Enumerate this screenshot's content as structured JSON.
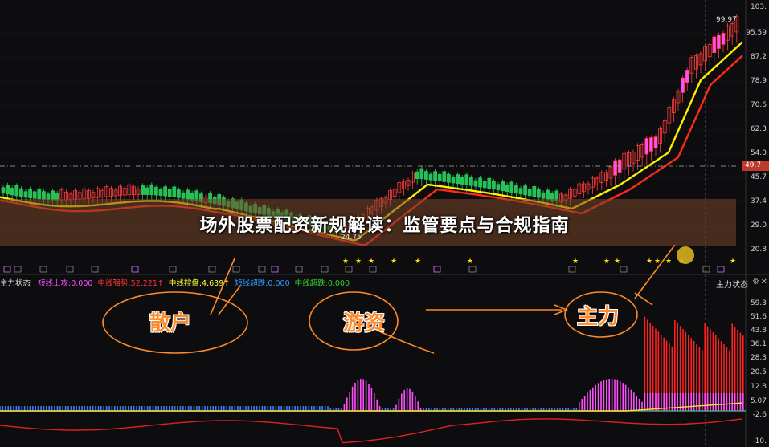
{
  "banner": {
    "title": "场外股票配资新规解读：监管要点与合规指南"
  },
  "price_axis": [
    "103.",
    "95.59",
    "87.2",
    "78.9",
    "70.6",
    "62.3",
    "54.0",
    "45.7",
    "37.4",
    "29.0",
    "20.8"
  ],
  "current_price_badge": "49.7",
  "price_tags": {
    "high": "99.97",
    "low": "24.75"
  },
  "indicator": {
    "name": "主力状态",
    "items": [
      {
        "label": "短线上攻:0.000",
        "color": "#ff4dff"
      },
      {
        "label": "中线强势:52.221",
        "color": "#ff3333",
        "arrow": "↑"
      },
      {
        "label": "中线控盘:4.639",
        "color": "#ffff33",
        "arrow": "↑"
      },
      {
        "label": "短线超跌:0.000",
        "color": "#3399ff"
      },
      {
        "label": "中线超跌:0.000",
        "color": "#33cc33"
      }
    ],
    "right_title": "主力状态",
    "axis": [
      "59.3",
      "51.6",
      "43.8",
      "36.1",
      "28.3",
      "20.5",
      "12.8",
      "5.07",
      "-2.6",
      "-10."
    ]
  },
  "notes": {
    "retail": "散户",
    "hot_money": "游资",
    "main_force": "主力"
  },
  "colors": {
    "up": "#ff3b3b",
    "down": "#27c257",
    "ma_yellow": "#ffee00",
    "ma_red": "#ff2a1a"
  }
}
